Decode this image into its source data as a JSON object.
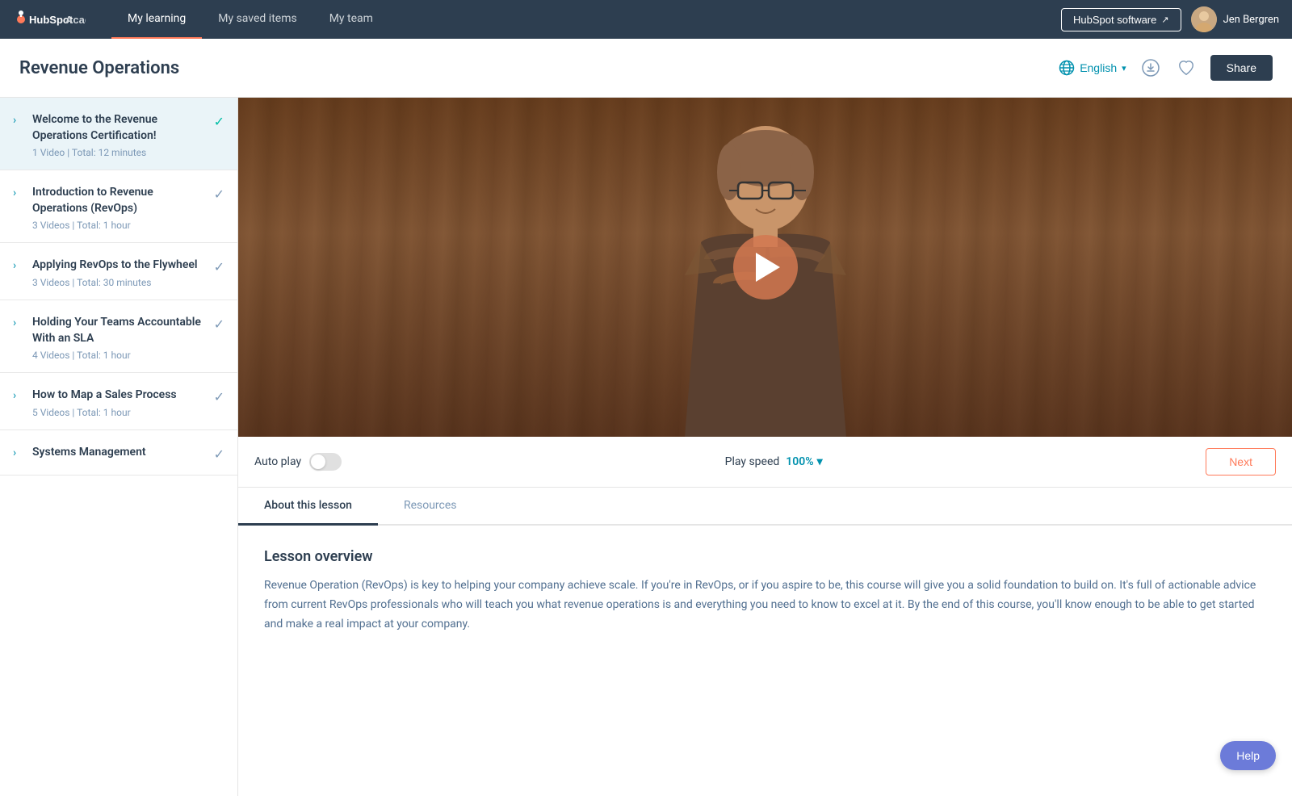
{
  "nav": {
    "logo_text": "Academy",
    "links": [
      {
        "id": "my-learning",
        "label": "My learning",
        "active": true
      },
      {
        "id": "my-saved-items",
        "label": "My saved items",
        "active": false
      },
      {
        "id": "my-team",
        "label": "My team",
        "active": false
      }
    ],
    "hubspot_btn": "HubSpot software",
    "username": "Jen Bergren"
  },
  "header": {
    "title": "Revenue Operations",
    "language": "English",
    "share_label": "Share"
  },
  "sidebar": {
    "items": [
      {
        "id": "welcome",
        "title": "Welcome to the Revenue Operations Certification!",
        "meta": "1 Video | Total: 12 minutes",
        "active": true,
        "check": true
      },
      {
        "id": "intro",
        "title": "Introduction to Revenue Operations (RevOps)",
        "meta": "3 Videos | Total: 1 hour",
        "active": false,
        "check": false
      },
      {
        "id": "applying",
        "title": "Applying RevOps to the Flywheel",
        "meta": "3 Videos | Total: 30 minutes",
        "active": false,
        "check": false
      },
      {
        "id": "holding",
        "title": "Holding Your Teams Accountable With an SLA",
        "meta": "4 Videos | Total: 1 hour",
        "active": false,
        "check": false
      },
      {
        "id": "map-sales",
        "title": "How to Map a Sales Process",
        "meta": "5 Videos | Total: 1 hour",
        "active": false,
        "check": false
      },
      {
        "id": "systems",
        "title": "Systems Management",
        "meta": "",
        "active": false,
        "check": false
      }
    ]
  },
  "video": {
    "autoplay_label": "Auto play",
    "playspeed_label": "Play speed",
    "playspeed_value": "100%",
    "next_label": "Next"
  },
  "tabs": [
    {
      "id": "about",
      "label": "About this lesson",
      "active": true
    },
    {
      "id": "resources",
      "label": "Resources",
      "active": false
    }
  ],
  "lesson": {
    "overview_title": "Lesson overview",
    "overview_text": "Revenue Operation (RevOps) is key to helping your company achieve scale. If you're in RevOps, or if you aspire to be, this course will give you a solid foundation to build on. It's full of actionable advice from current RevOps professionals who will teach you what revenue operations is and everything you need to know to excel at it. By the end of this course, you'll know enough to be able to get started and make a real impact at your company."
  },
  "help": {
    "label": "Help"
  }
}
